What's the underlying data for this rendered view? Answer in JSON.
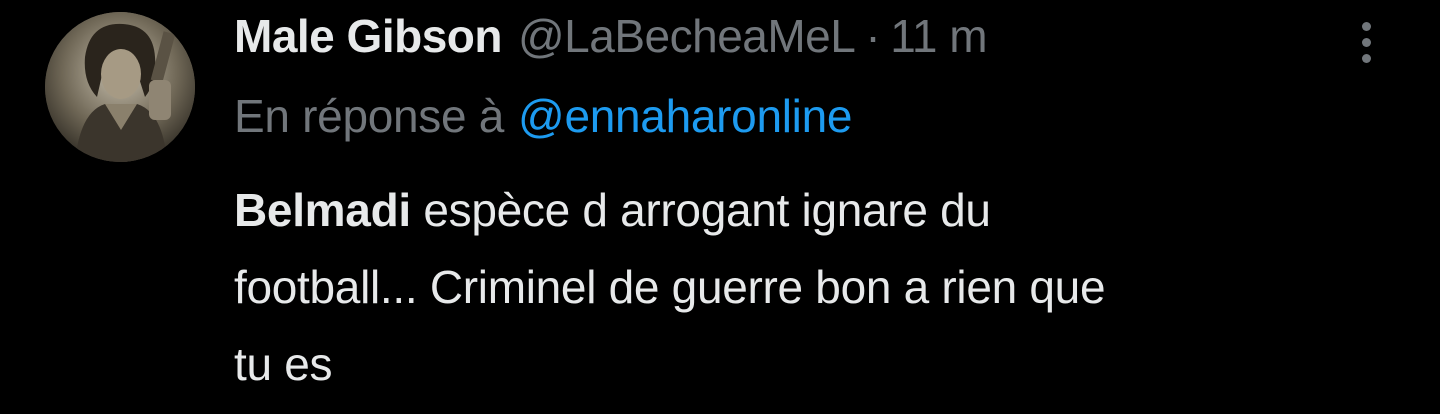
{
  "author": {
    "name": "Male Gibson",
    "handle": "@LaBecheaMeL",
    "separator": "·",
    "time": "11 m"
  },
  "reply": {
    "prefix": "En réponse à",
    "mention": "@ennaharonline"
  },
  "tweet": {
    "bold_word": "Belmadi",
    "text_line1": " espèce d arrogant ignare du",
    "text_line2": "football... Criminel de guerre bon a rien que",
    "text_line3": "tu es"
  },
  "icons": {
    "more": "more-vertical-icon",
    "avatar": "profile-photo"
  },
  "colors": {
    "background": "#000000",
    "primary_text": "#e7e9ea",
    "secondary_text": "#71767b",
    "link": "#1d9bf0"
  }
}
